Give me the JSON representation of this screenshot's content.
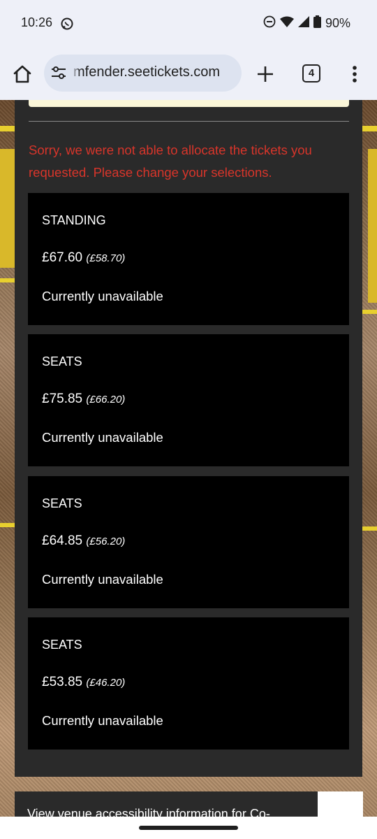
{
  "status_bar": {
    "time": "10:26",
    "battery": "90%",
    "icons": [
      "whatsapp-icon",
      "do-not-disturb-icon",
      "wifi-icon",
      "signal-icon",
      "battery-icon"
    ]
  },
  "browser": {
    "url": "mfender.seetickets.com",
    "tab_count": "4",
    "icons": [
      "home-icon",
      "site-settings-icon",
      "plus-icon",
      "tabs-icon",
      "more-vert-icon"
    ]
  },
  "page": {
    "error_message": "Sorry, we were not able to allocate the tickets you requested. Please change your selections.",
    "tickets": [
      {
        "type": "STANDING",
        "price": "£67.60",
        "fee_note": "(£58.70)",
        "status": "Currently unavailable"
      },
      {
        "type": "SEATS",
        "price": "£75.85",
        "fee_note": "(£66.20)",
        "status": "Currently unavailable"
      },
      {
        "type": "SEATS",
        "price": "£64.85",
        "fee_note": "(£56.20)",
        "status": "Currently unavailable"
      },
      {
        "type": "SEATS",
        "price": "£53.85",
        "fee_note": "(£46.20)",
        "status": "Currently unavailable"
      }
    ],
    "footer_text": "View venue accessibility information for Co-"
  },
  "colors": {
    "error": "#d8352a",
    "panel": "#2a2a2a",
    "card": "#000000",
    "accent_yellow": "#e8cf2e",
    "browser_chrome": "#eef0f8"
  }
}
